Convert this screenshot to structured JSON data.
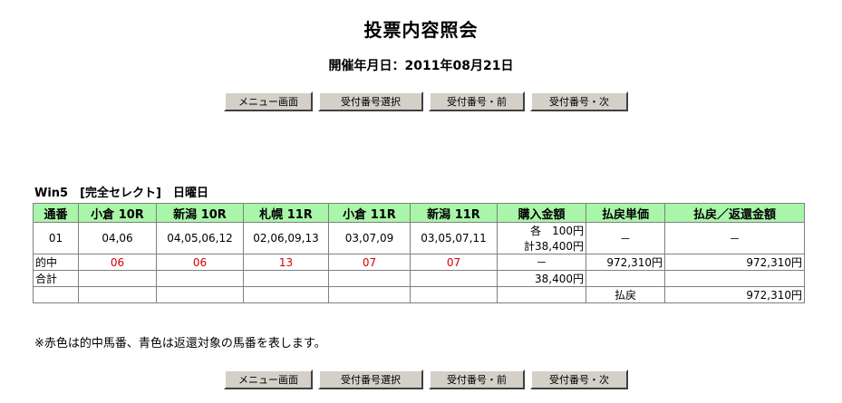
{
  "page": {
    "title": "投票内容照会",
    "date_label": "開催年月日：2011年08月21日"
  },
  "buttons": {
    "menu": "メニュー画面",
    "select": "受付番号選択",
    "prev": "受付番号・前",
    "next": "受付番号・次"
  },
  "section_title": "Win5　[完全セレクト]　日曜日",
  "table": {
    "headers": [
      "通番",
      "小倉 10R",
      "新潟 10R",
      "札幌 11R",
      "小倉 11R",
      "新潟 11R",
      "購入金額",
      "払戻単価",
      "払戻／返還金額"
    ],
    "row1": {
      "no": "01",
      "picks": [
        "04,06",
        "04,05,06,12",
        "02,06,09,13",
        "03,07,09",
        "03,05,07,11"
      ],
      "amount_each": "各　100円",
      "amount_total": "計38,400円",
      "unit": "－",
      "refund": "－"
    },
    "hit": {
      "label": "的中",
      "values": [
        "06",
        "06",
        "13",
        "07",
        "07"
      ],
      "amount": "－",
      "unit": "972,310円",
      "refund": "972,310円"
    },
    "total": {
      "label": "合計",
      "amount": "38,400円"
    },
    "payout": {
      "label": "払戻",
      "refund": "972,310円"
    }
  },
  "note": "※赤色は的中馬番、青色は返還対象の馬番を表します。",
  "colors": {
    "header_bg": "#a9f5a9",
    "hit_text": "#d40000",
    "button_bg": "#d4d0c8"
  }
}
